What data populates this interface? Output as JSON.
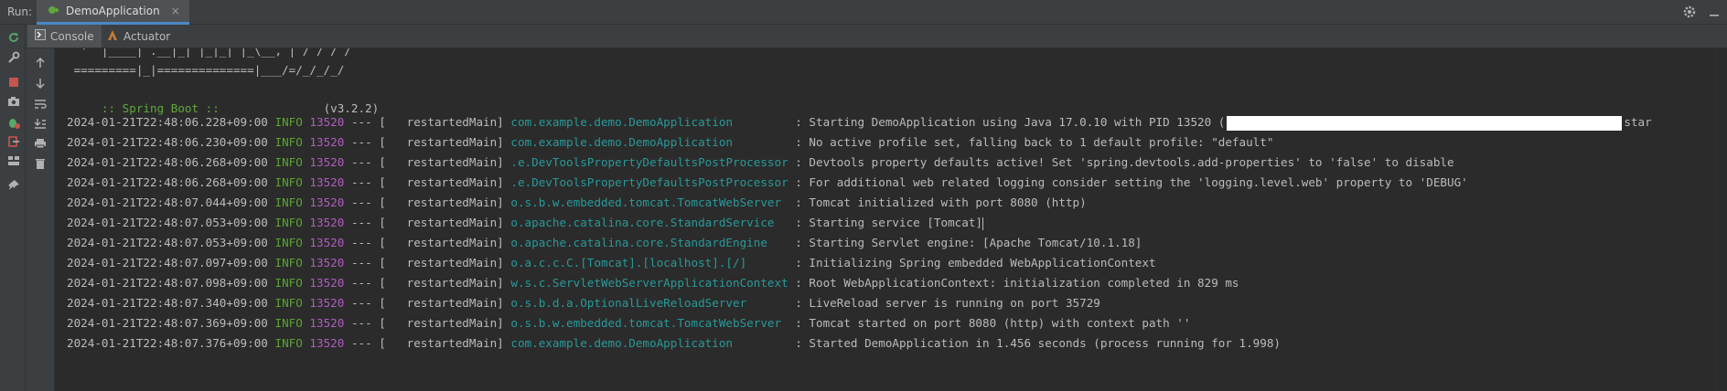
{
  "run_bar": {
    "label": "Run:",
    "tab_name": "DemoApplication",
    "tab_close": "×"
  },
  "tool_tabs": {
    "console": "Console",
    "actuator": "Actuator"
  },
  "colors": {
    "background": "#2b2b2b",
    "panel": "#3c3f41",
    "info": "#5ba334",
    "pid": "#b15cc1",
    "logger": "#299999",
    "spring_banner": "#62a73e"
  },
  "console": {
    "banner": [
      "  '  |____| .__|_| |_|_| |_\\__, | / / / /",
      " =========|_|==============|___/=/_/_/_/"
    ],
    "spring_label": " :: Spring Boot ::",
    "spring_version": "(v3.2.2)",
    "logs": [
      {
        "ts": "2024-01-21T22:48:06.228+09:00",
        "level": "INFO",
        "pid": "13520",
        "sep": "--- [",
        "thread": "  restartedMain]",
        "logger": "com.example.demo.DemoApplication        ",
        "msg": ": Starting DemoApplication using Java 17.0.10 with PID 13520 (",
        "tail": "star"
      },
      {
        "ts": "2024-01-21T22:48:06.230+09:00",
        "level": "INFO",
        "pid": "13520",
        "sep": "--- [",
        "thread": "  restartedMain]",
        "logger": "com.example.demo.DemoApplication        ",
        "msg": ": No active profile set, falling back to 1 default profile: \"default\""
      },
      {
        "ts": "2024-01-21T22:48:06.268+09:00",
        "level": "INFO",
        "pid": "13520",
        "sep": "--- [",
        "thread": "  restartedMain]",
        "logger": ".e.DevToolsPropertyDefaultsPostProcessor",
        "msg": ": Devtools property defaults active! Set 'spring.devtools.add-properties' to 'false' to disable"
      },
      {
        "ts": "2024-01-21T22:48:06.268+09:00",
        "level": "INFO",
        "pid": "13520",
        "sep": "--- [",
        "thread": "  restartedMain]",
        "logger": ".e.DevToolsPropertyDefaultsPostProcessor",
        "msg": ": For additional web related logging consider setting the 'logging.level.web' property to 'DEBUG'"
      },
      {
        "ts": "2024-01-21T22:48:07.044+09:00",
        "level": "INFO",
        "pid": "13520",
        "sep": "--- [",
        "thread": "  restartedMain]",
        "logger": "o.s.b.w.embedded.tomcat.TomcatWebServer ",
        "msg": ": Tomcat initialized with port 8080 (http)"
      },
      {
        "ts": "2024-01-21T22:48:07.053+09:00",
        "level": "INFO",
        "pid": "13520",
        "sep": "--- [",
        "thread": "  restartedMain]",
        "logger": "o.apache.catalina.core.StandardService  ",
        "msg": ": Starting service [Tomcat]"
      },
      {
        "ts": "2024-01-21T22:48:07.053+09:00",
        "level": "INFO",
        "pid": "13520",
        "sep": "--- [",
        "thread": "  restartedMain]",
        "logger": "o.apache.catalina.core.StandardEngine   ",
        "msg": ": Starting Servlet engine: [Apache Tomcat/10.1.18]"
      },
      {
        "ts": "2024-01-21T22:48:07.097+09:00",
        "level": "INFO",
        "pid": "13520",
        "sep": "--- [",
        "thread": "  restartedMain]",
        "logger": "o.a.c.c.C.[Tomcat].[localhost].[/]      ",
        "msg": ": Initializing Spring embedded WebApplicationContext"
      },
      {
        "ts": "2024-01-21T22:48:07.098+09:00",
        "level": "INFO",
        "pid": "13520",
        "sep": "--- [",
        "thread": "  restartedMain]",
        "logger": "w.s.c.ServletWebServerApplicationContext",
        "msg": ": Root WebApplicationContext: initialization completed in 829 ms"
      },
      {
        "ts": "2024-01-21T22:48:07.340+09:00",
        "level": "INFO",
        "pid": "13520",
        "sep": "--- [",
        "thread": "  restartedMain]",
        "logger": "o.s.b.d.a.OptionalLiveReloadServer      ",
        "msg": ": LiveReload server is running on port 35729"
      },
      {
        "ts": "2024-01-21T22:48:07.369+09:00",
        "level": "INFO",
        "pid": "13520",
        "sep": "--- [",
        "thread": "  restartedMain]",
        "logger": "o.s.b.w.embedded.tomcat.TomcatWebServer ",
        "msg": ": Tomcat started on port 8080 (http) with context path ''"
      },
      {
        "ts": "2024-01-21T22:48:07.376+09:00",
        "level": "INFO",
        "pid": "13520",
        "sep": "--- [",
        "thread": "  restartedMain]",
        "logger": "com.example.demo.DemoApplication        ",
        "msg": ": Started DemoApplication in 1.456 seconds (process running for 1.998)"
      }
    ]
  },
  "icons": {
    "left_strip": [
      "rerun-icon",
      "wrench-icon",
      "stop-icon",
      "camera-icon",
      "debug-bug-icon",
      "exit-icon",
      "layout-icon",
      "pin-icon"
    ],
    "second_strip": [
      "scroll-up-icon",
      "scroll-down-icon",
      "soft-wrap-icon",
      "scroll-to-end-icon",
      "print-icon",
      "trash-icon"
    ]
  }
}
